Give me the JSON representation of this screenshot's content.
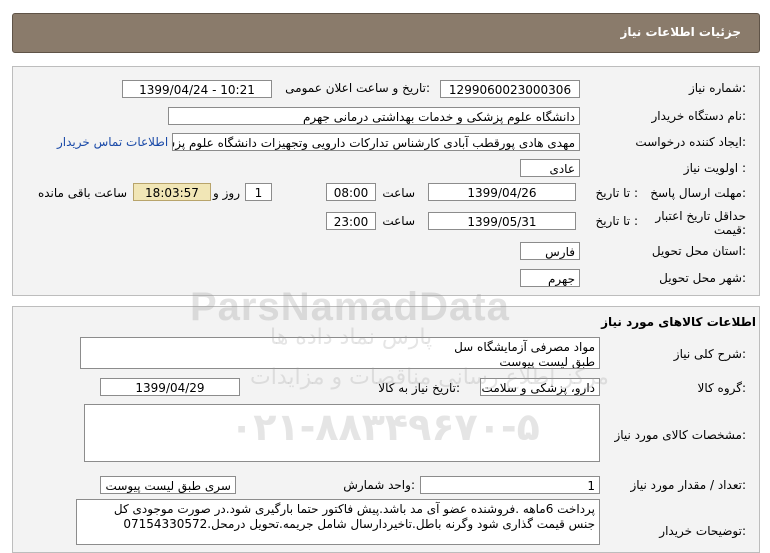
{
  "header": {
    "title": "جزئیات اطلاعات نیاز"
  },
  "need_info": {
    "need_number_label": "شماره نیاز:",
    "need_number": "1299060023000306",
    "announce_label": "تاریخ و ساعت اعلان عمومی:",
    "announce_value": "1399/04/24 - 10:21",
    "buyer_org_label": "نام دستگاه خریدار:",
    "buyer_org": "دانشگاه علوم پزشکی و خدمات بهداشتی درمانی جهرم",
    "creator_label": "ایجاد کننده درخواست:",
    "creator": "مهدی هادی پورقطب آبادی کارشناس تدارکات دارویی وتجهیزات دانشگاه علوم پزشکی",
    "contact_link": "اطلاعات تماس خریدار",
    "priority_label": "اولویت نیاز :",
    "priority": "عادی",
    "reply_deadline_label": "مهلت ارسال پاسخ:",
    "until_date_label": "تا تاریخ :",
    "reply_date": "1399/04/26",
    "time_label": "ساعت",
    "reply_time": "08:00",
    "days_value": "1",
    "days_label": "روز و",
    "remaining_time": "18:03:57",
    "remaining_label": "ساعت باقی مانده",
    "price_validity_label": "حداقل تاریخ اعتبار قیمت:",
    "price_until_label": "تا تاریخ :",
    "price_date": "1399/05/31",
    "price_time_label": "ساعت",
    "price_time": "23:00",
    "province_label": "استان محل تحویل:",
    "province": "فارس",
    "city_label": "شهر محل تحویل:",
    "city": "جهرم"
  },
  "goods": {
    "section_title": "اطلاعات کالاهای مورد نیاز",
    "summary_label": "شرح کلی نیاز:",
    "summary_line1": "مواد مصرفی آزمایشگاه سل",
    "summary_line2": "طبق لیست پیوست",
    "group_label": "گروه کالا:",
    "group_value": "دارو، پزشکی و سلامت",
    "need_date_label": "تاریخ نیاز به کالا:",
    "need_date": "1399/04/29",
    "specs_label": "مشخصات کالای مورد نیاز:",
    "specs_value": "",
    "qty_label": "تعداد / مقدار مورد نیاز:",
    "qty_value": "1",
    "unit_label": "واحد شمارش:",
    "unit_value": "سری طبق لیست پیوست",
    "buyer_notes_label": "توضیحات خریدار:",
    "buyer_notes_line1": "پرداخت 6ماهه .فروشنده عضو آی مد باشد.پیش فاکتور حتما بارگیری شود.در صورت موجودی کل",
    "buyer_notes_line2": "جنس قیمت گذاری شود وگرنه باطل.تاخیردارسال شامل جریمه.تحویل درمحل.07154330572"
  },
  "watermark": {
    "brand": "ParsNamadData",
    "line1": "پارس نماد داده ها",
    "line2": "مرکز اطلاع رسانی مناقصات و مزایدات",
    "phone": "۰۲۱-۸۸۳۴۹۶۷۰-۵"
  },
  "colors": {
    "header_bg": "#8a7b6b",
    "panel_bg": "#f3f3f3",
    "link": "#1a4aa8",
    "remaining_bg": "#f1e6b6"
  }
}
